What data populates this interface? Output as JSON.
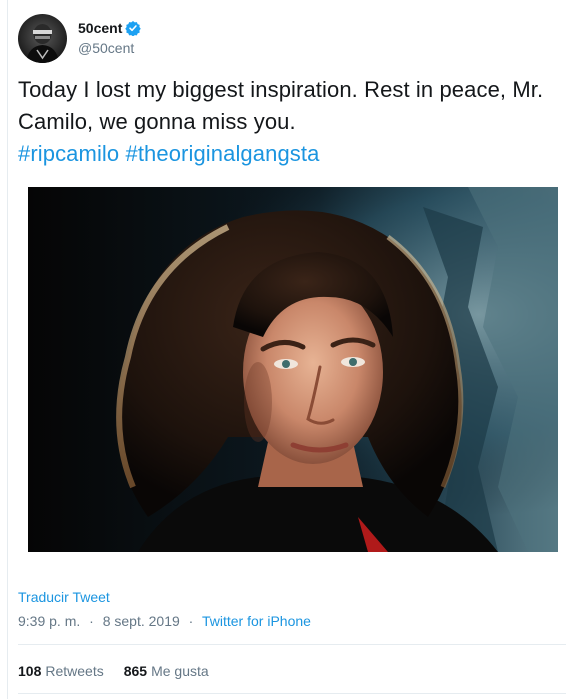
{
  "user": {
    "display_name": "50cent",
    "handle": "@50cent",
    "avatar_icon": "user-avatar"
  },
  "tweet": {
    "text": "Today I lost my biggest inspiration. Rest in peace, Mr. Camilo, we gonna miss you.",
    "hashtags": [
      "#ripcamilo",
      "#theoriginalgangsta"
    ]
  },
  "translate_label": "Traducir Tweet",
  "meta": {
    "time": "9:39 p. m.",
    "separator": "·",
    "date": "8 sept. 2019",
    "client": "Twitter for iPhone"
  },
  "stats": {
    "retweets_count": "108",
    "retweets_label": "Retweets",
    "likes_count": "865",
    "likes_label": "Me gusta"
  },
  "colors": {
    "link": "#1b95e0",
    "text": "#14171a",
    "muted": "#657786",
    "border": "#e6ecf0"
  }
}
